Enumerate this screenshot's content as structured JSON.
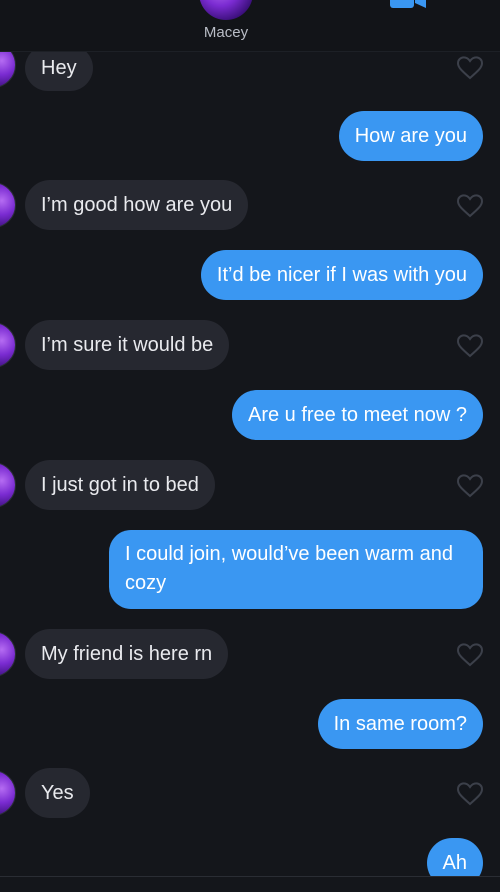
{
  "header": {
    "name": "Macey"
  },
  "messages": [
    {
      "from": "them",
      "text": "Hey"
    },
    {
      "from": "me",
      "text": "How are you"
    },
    {
      "from": "them",
      "text": "I’m good how are you"
    },
    {
      "from": "me",
      "text": "It’d be nicer if I was with you"
    },
    {
      "from": "them",
      "text": "I’m sure it would be"
    },
    {
      "from": "me",
      "text": "Are u free to meet now ?"
    },
    {
      "from": "them",
      "text": "I just got in to bed"
    },
    {
      "from": "me",
      "text": "I could join, would’ve been warm and cozy"
    },
    {
      "from": "them",
      "text": "My friend is here rn"
    },
    {
      "from": "me",
      "text": "In same room?"
    },
    {
      "from": "them",
      "text": "Yes"
    },
    {
      "from": "me",
      "text": "Ah"
    }
  ],
  "colors": {
    "sent_bubble": "#3a97f2",
    "received_bubble": "#262830",
    "background": "#14161b"
  }
}
